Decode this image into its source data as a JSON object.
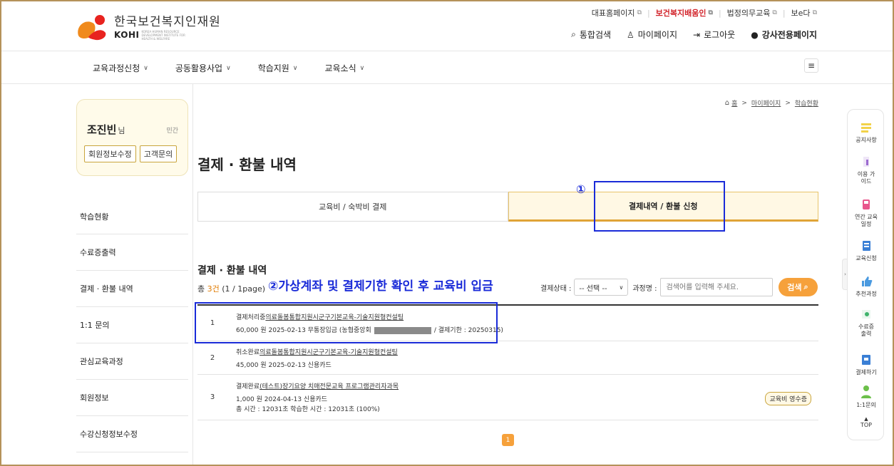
{
  "header": {
    "logo_ko": "한국보건복지인재원",
    "logo_en": "KOHI",
    "logo_en_sub": "KOREA HUMAN RESOURCE DEVELOPMENT INSTITUTE FOR HEALTH & WELFARE",
    "toplinks": [
      "대표홈페이지",
      "보건복지배움인",
      "법정의무교육",
      "보e다"
    ],
    "util": {
      "search": "통합검색",
      "mypage": "마이페이지",
      "logout": "로그아웃",
      "instructor": "강사전용페이지"
    }
  },
  "gnb": [
    "교육과정신청",
    "공동활용사업",
    "학습지원",
    "교육소식"
  ],
  "profile": {
    "name": "조진빈",
    "suffix": "님",
    "group": "민간",
    "edit_button": "회원정보수정",
    "inquiry_button": "고객문의"
  },
  "sidebar": [
    "학습현황",
    "수료증출력",
    "결제 · 환불 내역",
    "1:1 문의",
    "관심교육과정",
    "회원정보",
    "수강신청정보수정"
  ],
  "breadcrumb": {
    "home": "홈",
    "mypage": "마이페이지",
    "current": "학습현황"
  },
  "page_title": "결제 · 환불 내역",
  "tabs": [
    "교육비 / 숙박비 결제",
    "결제내역 / 환불 신청"
  ],
  "section": {
    "title": "결제 · 환불 내역",
    "total_prefix": "총 ",
    "total_count": "3건",
    "total_page": "(1 / 1page)"
  },
  "filter": {
    "status_label": "결제상태 :",
    "status_value": "-- 선택 --",
    "course_label": "과정명 :",
    "search_placeholder": "검색어를 입력해 주세요.",
    "search_button": "검색"
  },
  "rows": [
    {
      "num": "1",
      "status": "결제처리중",
      "course": "의료돌봄통합지원시군구기본교육-기술지원형컨설팅",
      "line2a": "60,000 원 2025-02-13 무통장입금 (농협중앙회",
      "line2b": "/ 결제기한 : 20250315)"
    },
    {
      "num": "2",
      "status": "취소완료",
      "course": "의료돌봄통합지원시군구기본교육-기술지원형컨설팅",
      "line2a": "45,000 원 2025-02-13 신용카드"
    },
    {
      "num": "3",
      "status": "결제완료",
      "course": "(테스트)장기요양 치매전문교육 프로그램관리자과목",
      "line2a": "1,000 원 2024-04-13 신용카드",
      "line3": "총 시간 : 12031초 학습한 시간 : 12031초 (100%)",
      "receipt": "교육비 영수증"
    }
  ],
  "pager": "1",
  "annotations": {
    "marker1": "①",
    "text2": "②가상계좌 및 결제기한 확인 후 교육비 입금"
  },
  "quick_menu": [
    "공지사항",
    "이용 가이드",
    "연간 교육일정",
    "교육신청",
    "추천과정",
    "수료증 출력",
    "결제하기",
    "1:1문의"
  ],
  "top_button": "TOP",
  "colors": {
    "accent": "#f6a13b",
    "annotation": "#1a2bd8",
    "brand_red": "#d2242b"
  }
}
